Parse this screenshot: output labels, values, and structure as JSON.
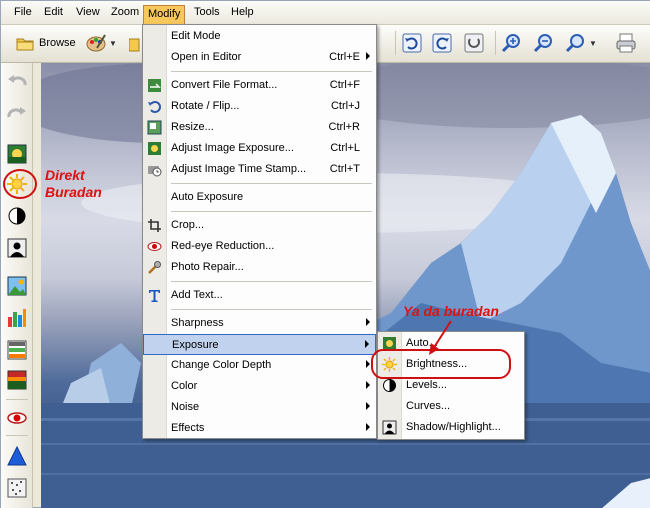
{
  "menubar": {
    "items": [
      "File",
      "Edit",
      "View",
      "Zoom",
      "Modify",
      "Tools",
      "Help"
    ],
    "active": "Modify"
  },
  "toolbar": {
    "browse_label": "Browse"
  },
  "modify_menu": {
    "items": [
      {
        "label": "Edit Mode",
        "shortcut": ""
      },
      {
        "label": "Open in Editor",
        "shortcut": "Ctrl+E",
        "arrow": true
      },
      {
        "label": "Convert File Format...",
        "shortcut": "Ctrl+F"
      },
      {
        "label": "Rotate / Flip...",
        "shortcut": "Ctrl+J"
      },
      {
        "label": "Resize...",
        "shortcut": "Ctrl+R"
      },
      {
        "label": "Adjust Image Exposure...",
        "shortcut": "Ctrl+L"
      },
      {
        "label": "Adjust Image Time Stamp...",
        "shortcut": "Ctrl+T"
      },
      {
        "label": "Auto Exposure",
        "shortcut": ""
      },
      {
        "label": "Crop...",
        "shortcut": ""
      },
      {
        "label": "Red-eye Reduction...",
        "shortcut": ""
      },
      {
        "label": "Photo Repair...",
        "shortcut": ""
      },
      {
        "label": "Add Text...",
        "shortcut": ""
      },
      {
        "label": "Sharpness",
        "shortcut": "",
        "arrow": true
      },
      {
        "label": "Exposure",
        "shortcut": "",
        "arrow": true
      },
      {
        "label": "Change Color Depth",
        "shortcut": "",
        "arrow": true
      },
      {
        "label": "Color",
        "shortcut": "",
        "arrow": true
      },
      {
        "label": "Noise",
        "shortcut": "",
        "arrow": true
      },
      {
        "label": "Effects",
        "shortcut": "",
        "arrow": true
      }
    ]
  },
  "exposure_submenu": {
    "items": [
      "Auto...",
      "Brightness...",
      "Levels...",
      "Curves...",
      "Shadow/Highlight..."
    ]
  },
  "annotations": {
    "left_note_line1": "Direkt",
    "left_note_line2": "Buradan",
    "right_note": "Ya da buradan"
  },
  "colors": {
    "annotation_red": "#e01010",
    "menu_highlight": "#c1d2ee",
    "active_menu": "#f6c75a"
  }
}
